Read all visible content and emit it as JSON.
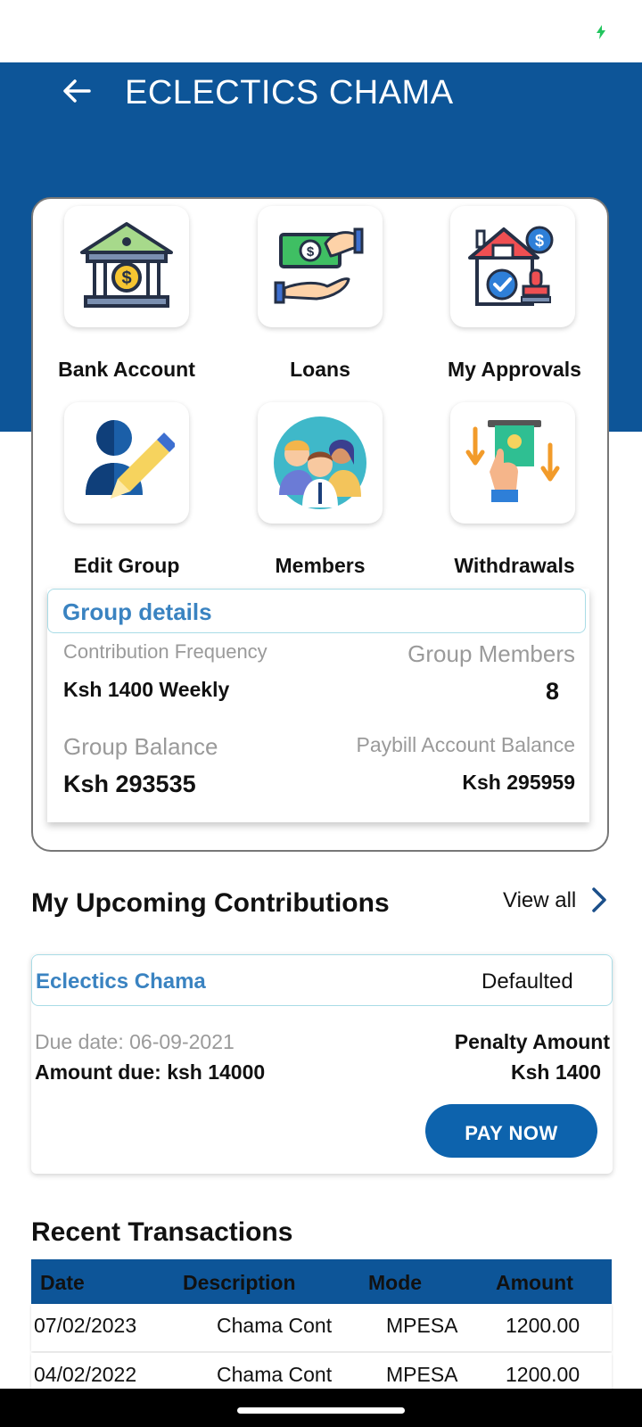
{
  "app": {
    "title": "ECLECTICS CHAMA"
  },
  "icons": {
    "back": "arrow-left-icon",
    "charging": "bolt-icon",
    "chevron": "chevron-right-icon"
  },
  "menu": [
    {
      "label": "Bank Account",
      "icon": "bank-icon"
    },
    {
      "label": "Loans",
      "icon": "money-hand-icon"
    },
    {
      "label": "My Approvals",
      "icon": "house-approval-icon"
    },
    {
      "label": "Edit Group",
      "icon": "user-edit-icon"
    },
    {
      "label": "Members",
      "icon": "members-group-icon"
    },
    {
      "label": "Withdrawals",
      "icon": "atm-withdrawal-icon"
    }
  ],
  "group_details": {
    "title": "Group details",
    "contribution_frequency_label": "Contribution Frequency",
    "contribution_frequency_value": "Ksh 1400 Weekly",
    "group_members_label": "Group Members",
    "group_members_value": "8",
    "group_balance_label": "Group Balance",
    "group_balance_value": "Ksh 293535",
    "paybill_balance_label": "Paybill Account Balance",
    "paybill_balance_value": "Ksh 295959"
  },
  "upcoming": {
    "title": "My Upcoming Contributions",
    "view_all": "View all",
    "card": {
      "name": "Eclectics Chama",
      "status": "Defaulted",
      "due_date": "Due date: 06-09-2021",
      "amount_due": "Amount due: ksh 14000",
      "penalty_label": "Penalty Amount",
      "penalty_value": "Ksh 1400",
      "pay_button": "PAY NOW"
    }
  },
  "transactions": {
    "title": "Recent Transactions",
    "columns": [
      "Date",
      "Description",
      "Mode",
      "Amount"
    ],
    "rows": [
      [
        "07/02/2023",
        "Chama Cont",
        "MPESA",
        "1200.00"
      ],
      [
        "04/02/2022",
        "Chama Cont",
        "MPESA",
        "1200.00"
      ]
    ]
  },
  "colors": {
    "primary": "#0d5598",
    "accent_text": "#3a83c1",
    "button": "#0d63ad"
  }
}
